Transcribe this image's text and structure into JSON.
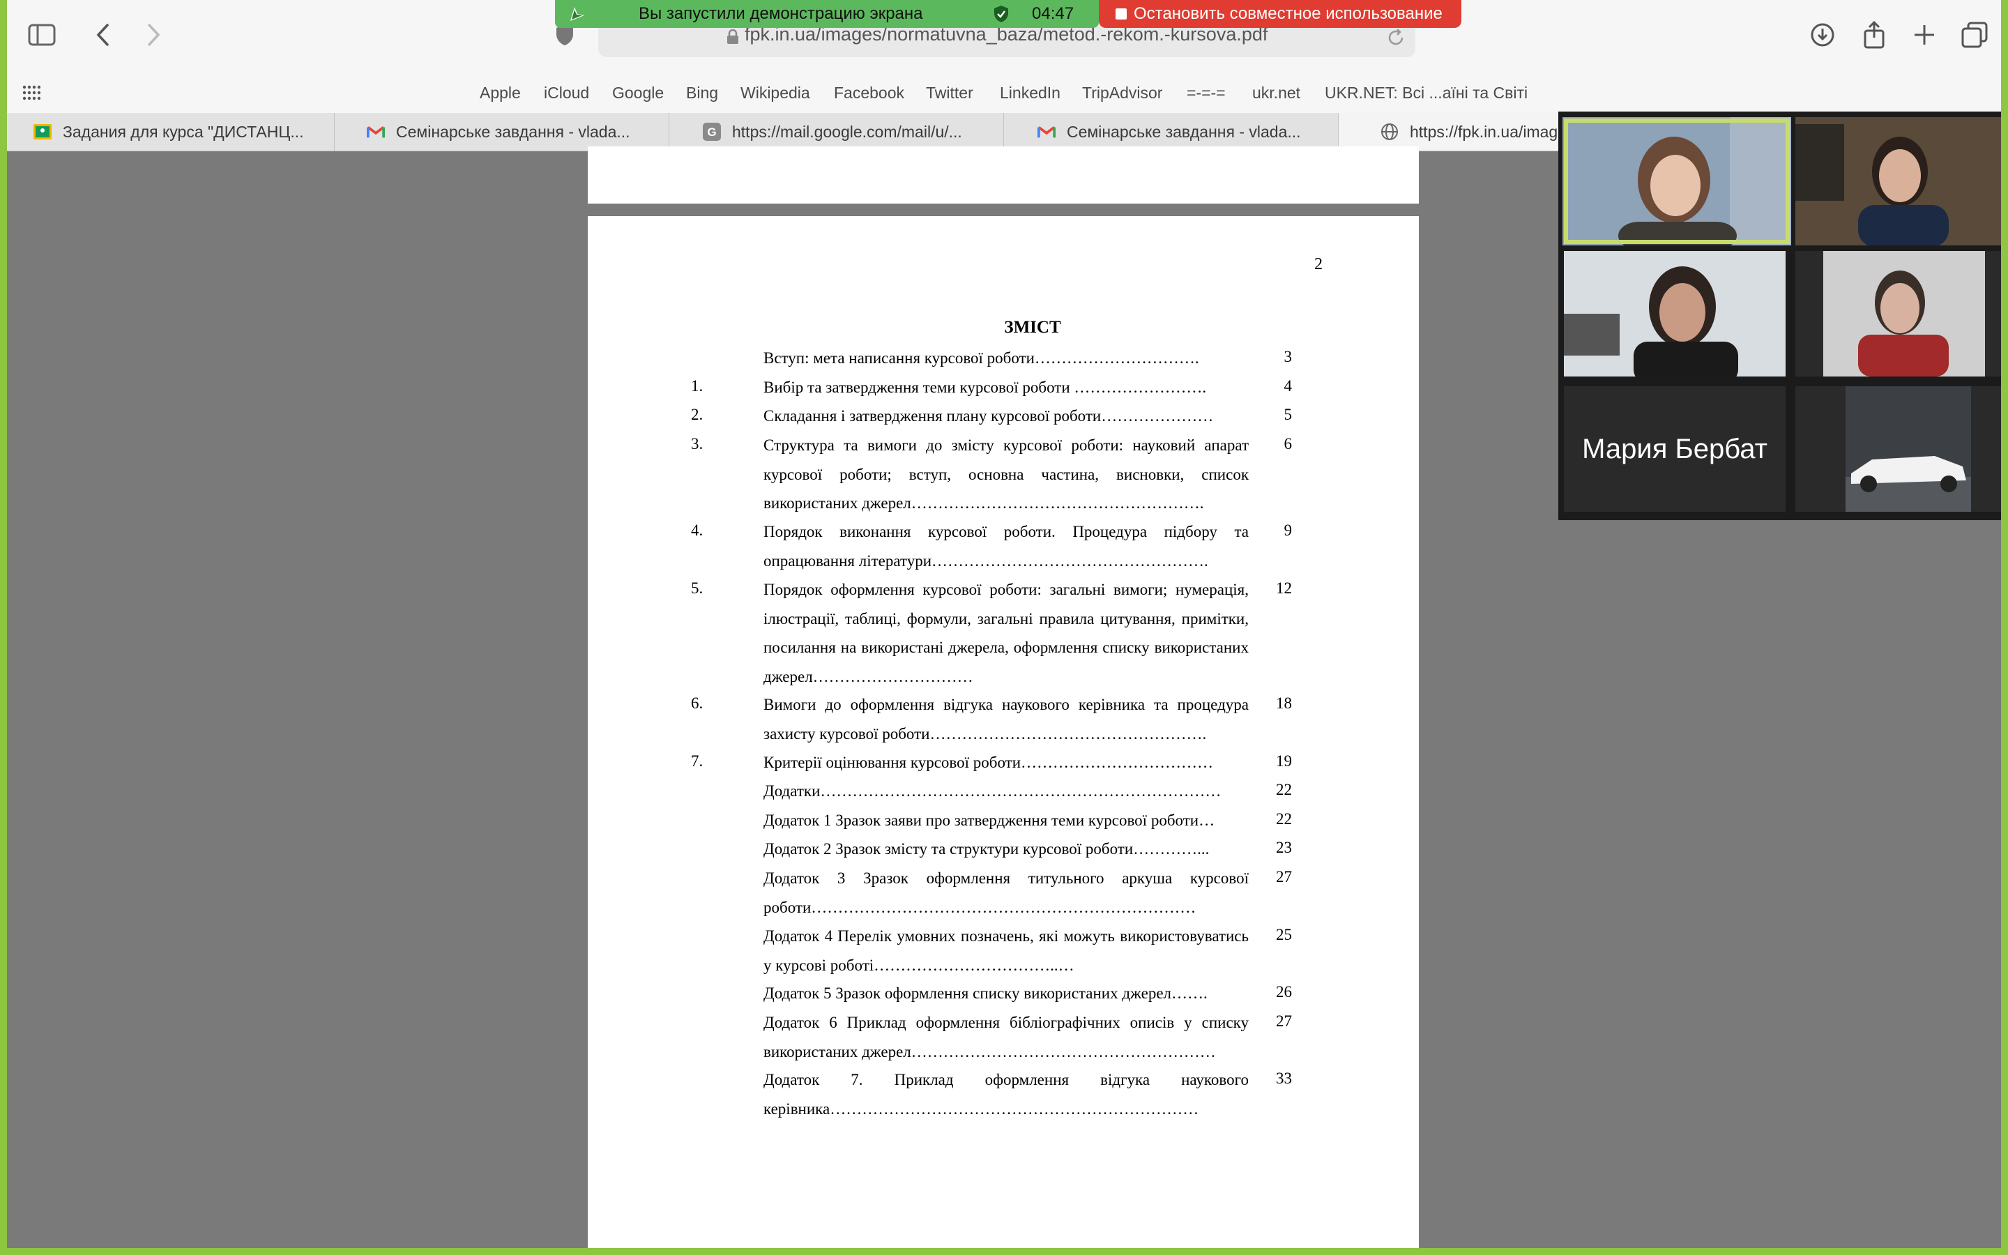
{
  "screen_share": {
    "status_text": "Вы запустили демонстрацию экрана",
    "timer": "04:47",
    "stop_label": "Остановить совместное использование"
  },
  "browser": {
    "url": "fpk.in.ua/images/normatuvna_baza/metod.-rekom.-kursova.pdf",
    "favorites": [
      "Apple",
      "iCloud",
      "Google",
      "Bing",
      "Wikipedia",
      "Facebook",
      "Twitter",
      "LinkedIn",
      "TripAdvisor",
      "=-=-=",
      "ukr.net",
      "UKR.NET: Всі ...аїні та Світі"
    ],
    "tabs": [
      {
        "label": "Задания для курса \"ДИСТАНЦ...",
        "icon": "classroom-icon"
      },
      {
        "label": "Семінарське завдання - vlada...",
        "icon": "gmail-icon"
      },
      {
        "label": "https://mail.google.com/mail/u/...",
        "icon": "google-icon"
      },
      {
        "label": "Семінарське завдання - vlada...",
        "icon": "gmail-icon"
      },
      {
        "label": "https://fpk.in.ua/imag",
        "icon": "globe-icon"
      }
    ]
  },
  "document": {
    "page_number": "2",
    "title": "ЗМІСТ",
    "toc": [
      {
        "num": "",
        "text": "Вступ: мета написання курсової роботи………………………….",
        "page": "3"
      },
      {
        "num": "1.",
        "text": "Вибір та затвердження теми курсової роботи …………………….",
        "page": "4"
      },
      {
        "num": "2.",
        "text": "Складання і затвердження плану курсової роботи…………………",
        "page": "5"
      },
      {
        "num": "3.",
        "text": "Структура та вимоги до змісту курсової роботи: науковий апарат курсової роботи; вступ, основна частина, висновки, список використаних джерел……………………………………………….",
        "page": "6"
      },
      {
        "num": "4.",
        "text": "Порядок виконання курсової роботи. Процедура підбору та опрацювання літератури…………………………………………….",
        "page": "9"
      },
      {
        "num": "5.",
        "text": "Порядок оформлення курсової роботи: загальні вимоги; нумерація, ілюстрації, таблиці, формули, загальні правила цитування, примітки, посилання на використані джерела, оформлення списку використаних джерел…………………………",
        "page": "12"
      },
      {
        "num": "6.",
        "text": "Вимоги до оформлення відгука наукового керівника та процедура захисту курсової роботи…………………………………………….",
        "page": "18"
      },
      {
        "num": "7.",
        "text": "Критерії оцінювання курсової роботи………………………………",
        "page": "19"
      },
      {
        "num": "",
        "text": "Додатки…………………………………………………………………",
        "page": "22"
      },
      {
        "num": "",
        "text": "Додаток 1 Зразок заяви про затвердження теми курсової роботи…",
        "page": "22"
      },
      {
        "num": "",
        "text": "Додаток 2 Зразок змісту та структури курсової роботи…………...",
        "page": "23"
      },
      {
        "num": "",
        "text": "Додаток 3 Зразок оформлення титульного аркуша курсової роботи………………………………………………………………",
        "page": "27"
      },
      {
        "num": "",
        "text": "Додаток 4 Перелік умовних позначень, які можуть використовуватись у курсові роботі……………………………..…",
        "page": "25"
      },
      {
        "num": "",
        "text": "Додаток 5 Зразок оформлення списку використаних джерел…….",
        "page": "26"
      },
      {
        "num": "",
        "text": "Додаток 6 Приклад оформлення бібліографічних описів у списку використаних джерел…………………………………………………",
        "page": "27"
      },
      {
        "num": "",
        "text": "Додаток 7. Приклад оформлення відгука наукового керівника……………………………………………………………",
        "page": "33"
      }
    ]
  },
  "video_call": {
    "participant_name": "Мария Бербат"
  },
  "colors": {
    "share_green": "#5cb85c",
    "share_red": "#e03c31",
    "active_speaker": "#c8dc6e",
    "frame_border": "#8dc63f"
  }
}
